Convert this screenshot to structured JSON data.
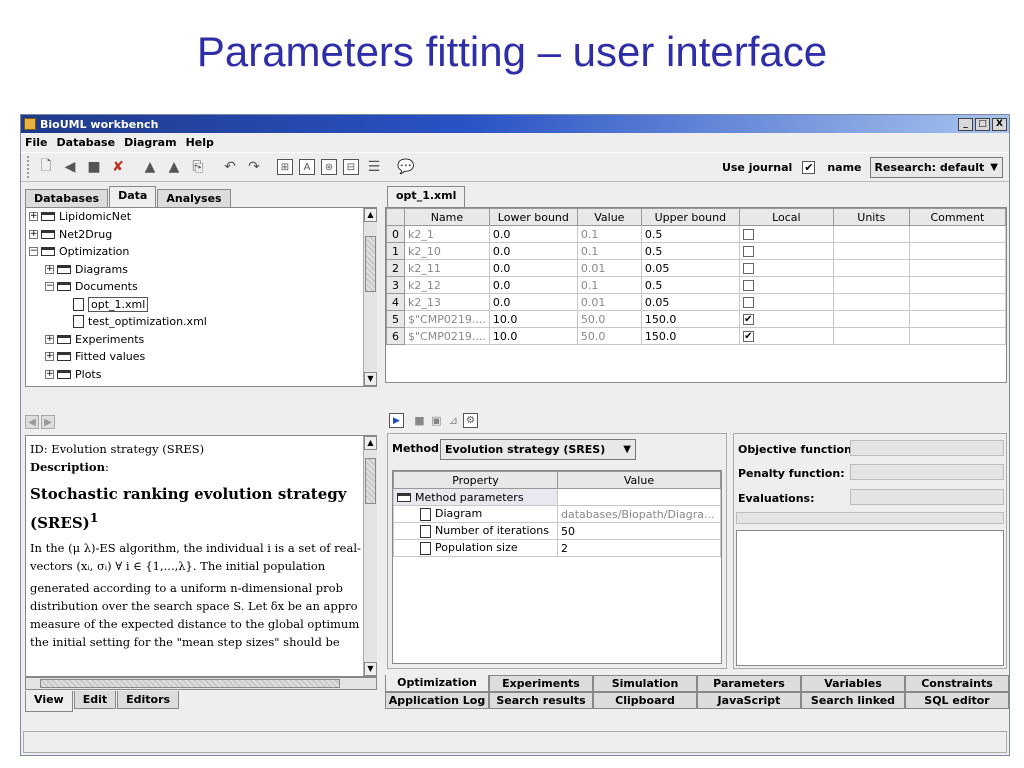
{
  "slide": {
    "title": "Parameters fitting – user interface"
  },
  "window": {
    "title": "BioUML workbench",
    "controls": [
      "_",
      "□",
      "X"
    ]
  },
  "menu": [
    "File",
    "Database",
    "Diagram",
    "Help"
  ],
  "toolbar": {
    "use_journal_label": "Use journal",
    "use_journal_checked": "✔",
    "name_label": "name",
    "journal_value": "Research: default"
  },
  "left_tabs": [
    "Databases",
    "Data",
    "Analyses"
  ],
  "tree": [
    {
      "label": "LipidomicNet",
      "depth": 0,
      "exp": "+",
      "type": "folder"
    },
    {
      "label": "Net2Drug",
      "depth": 0,
      "exp": "+",
      "type": "folder"
    },
    {
      "label": "Optimization",
      "depth": 0,
      "exp": "−",
      "type": "folder"
    },
    {
      "label": "Diagrams",
      "depth": 1,
      "exp": "+",
      "type": "folder"
    },
    {
      "label": "Documents",
      "depth": 1,
      "exp": "−",
      "type": "folder"
    },
    {
      "label": "opt_1.xml",
      "depth": 2,
      "exp": "",
      "type": "doc",
      "selected": true
    },
    {
      "label": "test_optimization.xml",
      "depth": 2,
      "exp": "",
      "type": "doc"
    },
    {
      "label": "Experiments",
      "depth": 1,
      "exp": "+",
      "type": "folder"
    },
    {
      "label": "Fitted values",
      "depth": 1,
      "exp": "+",
      "type": "folder"
    },
    {
      "label": "Plots",
      "depth": 1,
      "exp": "+",
      "type": "folder"
    }
  ],
  "doc_tab": "opt_1.xml",
  "params_table": {
    "headers": [
      "",
      "Name",
      "Lower bound",
      "Value",
      "Upper bound",
      "Local",
      "Units",
      "Comment"
    ],
    "rows": [
      {
        "n": "0",
        "name": "k2_1",
        "lower": "0.0",
        "value": "0.1",
        "upper": "0.5",
        "local": ""
      },
      {
        "n": "1",
        "name": "k2_10",
        "lower": "0.0",
        "value": "0.1",
        "upper": "0.5",
        "local": ""
      },
      {
        "n": "2",
        "name": "k2_11",
        "lower": "0.0",
        "value": "0.01",
        "upper": "0.05",
        "local": ""
      },
      {
        "n": "3",
        "name": "k2_12",
        "lower": "0.0",
        "value": "0.1",
        "upper": "0.5",
        "local": ""
      },
      {
        "n": "4",
        "name": "k2_13",
        "lower": "0.0",
        "value": "0.01",
        "upper": "0.05",
        "local": ""
      },
      {
        "n": "5",
        "name": "$\"CMP0219....",
        "lower": "10.0",
        "value": "50.0",
        "upper": "150.0",
        "local": "✔"
      },
      {
        "n": "6",
        "name": "$\"CMP0219....",
        "lower": "10.0",
        "value": "50.0",
        "upper": "150.0",
        "local": "✔"
      }
    ]
  },
  "description": {
    "id_label": "ID",
    "id_value": ": Evolution strategy (SRES)",
    "desc_label": "Description",
    "heading": "Stochastic ranking evolution strategy (SRES)",
    "heading_sup": "1",
    "lines": [
      "In the (μ λ)-ES algorithm, the individual i is a set of real-",
      "vectors (xᵢ, σᵢ) ∀ i ∈ {1,...,λ}. The initial population",
      "generated according to a uniform n-dimensional prob",
      "distribution over the search space S. Let δx be an appro",
      "measure of the expected distance to the global optimum",
      "the initial setting for the \"mean step sizes\" should be"
    ]
  },
  "view_tabs": [
    "View",
    "Edit",
    "Editors"
  ],
  "method": {
    "label": "Method:",
    "value": "Evolution strategy (SRES)",
    "prop_headers": [
      "Property",
      "Value"
    ],
    "group": "Method parameters",
    "props": [
      {
        "name": "Diagram",
        "value": "databases/Biopath/Diagra..."
      },
      {
        "name": "Number of iterations",
        "value": "50"
      },
      {
        "name": "Population size",
        "value": "2"
      }
    ]
  },
  "results": {
    "objective": "Objective function:",
    "penalty": "Penalty function:",
    "evaluations": "Evaluations:"
  },
  "bottom_tabs_top": [
    "Optimization",
    "Experiments",
    "Simulation",
    "Parameters",
    "Variables",
    "Constraints"
  ],
  "bottom_tabs_bottom": [
    "Application Log",
    "Search results",
    "Clipboard",
    "JavaScript",
    "Search linked",
    "SQL editor"
  ]
}
